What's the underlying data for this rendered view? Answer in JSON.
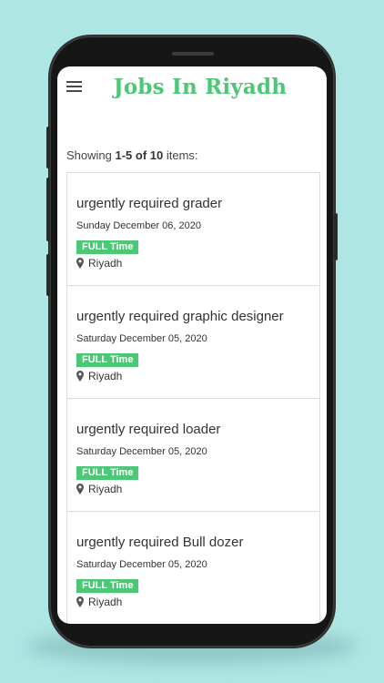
{
  "app": {
    "title": "Jobs In Riyadh"
  },
  "summary": {
    "prefix": "Showing ",
    "range": "1-5",
    "of": " of ",
    "total": "10",
    "suffix": " items:"
  },
  "jobs": [
    {
      "title": "urgently required grader",
      "date": "Sunday December 06, 2020",
      "type": "FULL Time",
      "location": "Riyadh"
    },
    {
      "title": "urgently required graphic designer",
      "date": "Saturday December 05, 2020",
      "type": "FULL Time",
      "location": "Riyadh"
    },
    {
      "title": "urgently required loader",
      "date": "Saturday December 05, 2020",
      "type": "FULL Time",
      "location": "Riyadh"
    },
    {
      "title": "urgently required Bull dozer",
      "date": "Saturday December 05, 2020",
      "type": "FULL Time",
      "location": "Riyadh"
    }
  ],
  "colors": {
    "brand": "#4cc776",
    "background": "#aee6e4"
  },
  "icons": {
    "menu": "menu-icon",
    "location": "map-marker-icon"
  }
}
